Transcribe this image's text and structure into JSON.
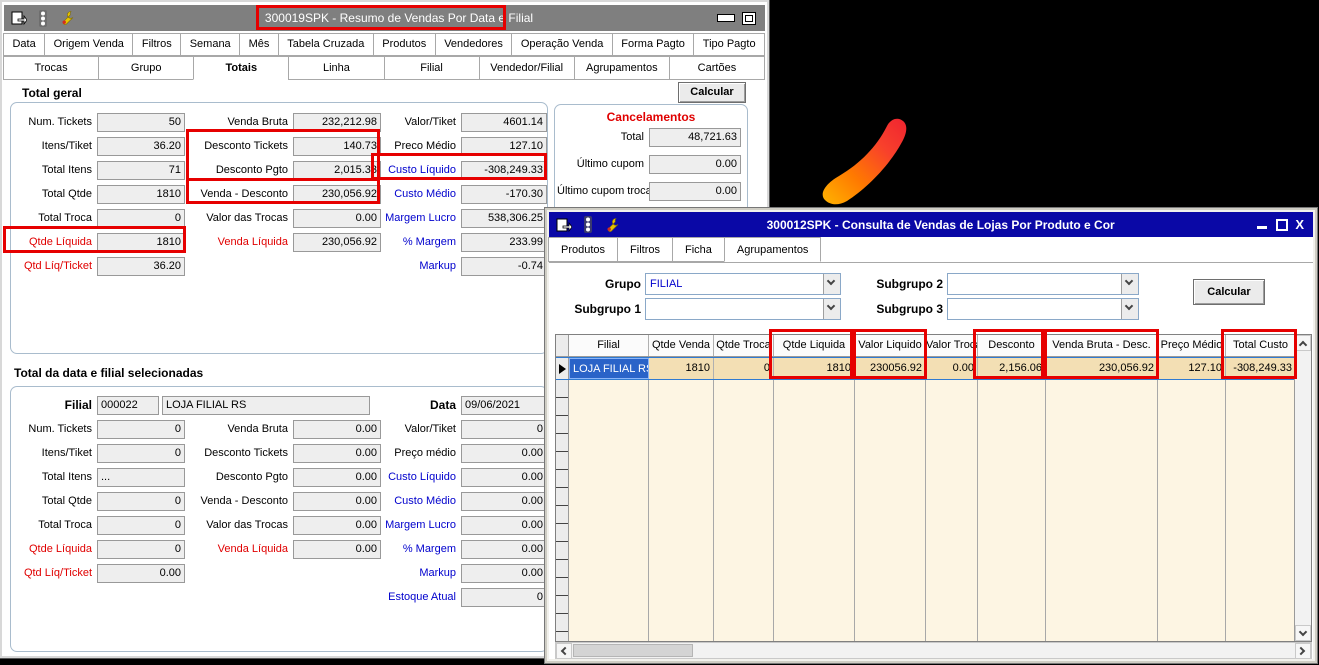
{
  "colors": {
    "desktop_bg": "#000000",
    "annotation_red": "#e60000",
    "titlebar_inactive": "#7f7f7f",
    "titlebar_active": "#0a08a6",
    "label_red": "#e00000",
    "label_blue": "#0000cd",
    "grid_body_bg": "#fdf5e3",
    "grid_row_bg": "#f3dfb4",
    "grid_selected_cell_bg": "#2a63c8",
    "logo_gradient_start": "#ffb400",
    "logo_gradient_end": "#ef2430"
  },
  "icons": {
    "titlebar_left": [
      "export-form-icon",
      "traffic-light-icon",
      "wrench-icon"
    ],
    "close_glyph": "X",
    "row_marker": "right-triangle"
  },
  "window1": {
    "title": "300019SPK - Resumo de Vendas Por Data e Filial",
    "menu": [
      "Data",
      "Origem Venda",
      "Filtros",
      "Semana",
      "Mês",
      "Tabela Cruzada",
      "Produtos",
      "Vendedores",
      "Operação Venda",
      "Forma Pagto",
      "Tipo Pagto"
    ],
    "tabs": [
      "Trocas",
      "Grupo",
      "Totais",
      "Linha",
      "Filial",
      "Vendedor/Filial",
      "Agrupamentos",
      "Cartões"
    ],
    "active_tab": "Totais",
    "calcular_label": "Calcular",
    "total_geral": {
      "heading": "Total geral",
      "col1": [
        {
          "label": "Num. Tickets",
          "value": "50"
        },
        {
          "label": "Itens/Tiket",
          "value": "36.20"
        },
        {
          "label": "Total Itens",
          "value": "71"
        },
        {
          "label": "Total Qtde",
          "value": "1810"
        },
        {
          "label": "Total Troca",
          "value": "0"
        },
        {
          "label": "Qtde Líquida",
          "value": "1810"
        },
        {
          "label": "Qtd Líq/Ticket",
          "value": "36.20"
        }
      ],
      "col2": [
        {
          "label": "Venda Bruta",
          "value": "232,212.98"
        },
        {
          "label": "Desconto Tickets",
          "value": "140.73"
        },
        {
          "label": "Desconto Pgto",
          "value": "2,015.33"
        },
        {
          "label": "Venda - Desconto",
          "value": "230,056.92"
        },
        {
          "label": "Valor das Trocas",
          "value": "0.00"
        },
        {
          "label": "Venda Líquida",
          "value": "230,056.92"
        }
      ],
      "col3": [
        {
          "label": "Valor/Tiket",
          "value": "4601.14"
        },
        {
          "label": "Preco Médio",
          "value": "127.10"
        },
        {
          "label": "Custo Líquido",
          "value": "-308,249.33"
        },
        {
          "label": "Custo Médio",
          "value": "-170.30"
        },
        {
          "label": "Margem Lucro",
          "value": "538,306.25"
        },
        {
          "label": "% Margem",
          "value": "233.99"
        },
        {
          "label": "Markup",
          "value": "-0.74"
        }
      ],
      "cancelamentos": {
        "title": "Cancelamentos",
        "rows": [
          {
            "label": "Total",
            "value": "48,721.63"
          },
          {
            "label": "Último cupom",
            "value": "0.00"
          },
          {
            "label": "Último cupom troca",
            "value": "0.00"
          }
        ]
      }
    },
    "total_filial": {
      "heading": "Total da data e filial selecionadas",
      "filial_label": "Filial",
      "filial_code": "000022",
      "filial_name": "LOJA FILIAL RS",
      "data_label": "Data",
      "data_value": "09/06/2021",
      "col1": [
        {
          "label": "Num. Tickets",
          "value": "0"
        },
        {
          "label": "Itens/Tiket",
          "value": "0"
        },
        {
          "label": "Total Itens",
          "value": "..."
        },
        {
          "label": "Total Qtde",
          "value": "0"
        },
        {
          "label": "Total Troca",
          "value": "0"
        },
        {
          "label": "Qtde Líquida",
          "value": "0"
        },
        {
          "label": "Qtd Líq/Ticket",
          "value": "0.00"
        }
      ],
      "col2": [
        {
          "label": "Venda Bruta",
          "value": "0.00"
        },
        {
          "label": "Desconto Tickets",
          "value": "0.00"
        },
        {
          "label": "Desconto Pgto",
          "value": "0.00"
        },
        {
          "label": "Venda - Desconto",
          "value": "0.00"
        },
        {
          "label": "Valor das Trocas",
          "value": "0.00"
        },
        {
          "label": "Venda Líquida",
          "value": "0.00"
        }
      ],
      "col3": [
        {
          "label": "Valor/Tiket",
          "value": "0"
        },
        {
          "label": "Preço médio",
          "value": "0.00"
        },
        {
          "label": "Custo Líquido",
          "value": "0.00"
        },
        {
          "label": "Custo Médio",
          "value": "0.00"
        },
        {
          "label": "Margem Lucro",
          "value": "0.00"
        },
        {
          "label": "% Margem",
          "value": "0.00"
        },
        {
          "label": "Markup",
          "value": "0.00"
        },
        {
          "label": "Estoque Atual",
          "value": "0"
        }
      ]
    }
  },
  "window2": {
    "title": "300012SPK - Consulta de Vendas de Lojas Por Produto e Cor",
    "tabs": [
      "Produtos",
      "Filtros",
      "Ficha",
      "Agrupamentos"
    ],
    "active_tab": "Agrupamentos",
    "calcular_label": "Calcular",
    "filters": {
      "grupo_label": "Grupo",
      "grupo_value": "FILIAL",
      "subgrupo1_label": "Subgrupo 1",
      "subgrupo1_value": "",
      "subgrupo2_label": "Subgrupo 2",
      "subgrupo2_value": "",
      "subgrupo3_label": "Subgrupo 3",
      "subgrupo3_value": ""
    },
    "grid": {
      "columns": [
        "Filial",
        "Qtde Venda",
        "Qtde Troca",
        "Qtde Liquida",
        "Valor Liquido",
        "Valor Troca",
        "Desconto",
        "Venda Bruta - Desc.",
        "Preço Médio",
        "Total Custo"
      ],
      "row": [
        "LOJA FILIAL RS",
        "1810",
        "0",
        "1810",
        "230056.92",
        "0.00",
        "2,156.06",
        "230,056.92",
        "127.10",
        "-308,249.33"
      ]
    }
  },
  "annotations": {
    "color": "#e60000",
    "highlighted": [
      "window1 title",
      "Desconto Tickets + Desconto Pgto",
      "Venda - Desconto",
      "Qtde Líquida",
      "Custo Líquido",
      "grid Qtde Liquida",
      "grid Valor Liquido",
      "grid Desconto",
      "grid Venda Bruta - Desc.",
      "grid Total Custo"
    ]
  }
}
